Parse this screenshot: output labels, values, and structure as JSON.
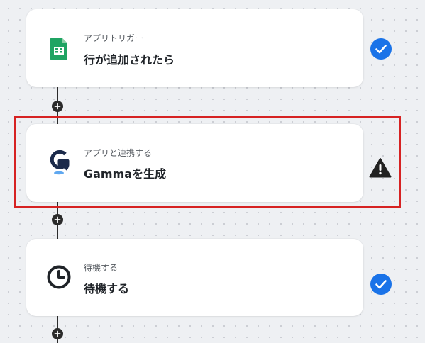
{
  "flow": {
    "steps": [
      {
        "subtitle": "アプリトリガー",
        "title": "行が追加されたら",
        "app_icon": "google-sheets-icon",
        "status": "complete"
      },
      {
        "subtitle": "アプリと連携する",
        "title": "Gammaを生成",
        "app_icon": "gamma-logo-icon",
        "status": "warning"
      },
      {
        "subtitle": "待機する",
        "title": "待機する",
        "app_icon": "clock-icon",
        "status": "complete"
      }
    ],
    "highlighted_step": 2
  },
  "colors": {
    "check_blue": "#1a73e8",
    "warning_dark": "#222222",
    "highlight_red": "#d62222",
    "sheets_green": "#1fa463",
    "gamma_navy": "#1b2a4a",
    "connector": "#2b2b2b"
  }
}
